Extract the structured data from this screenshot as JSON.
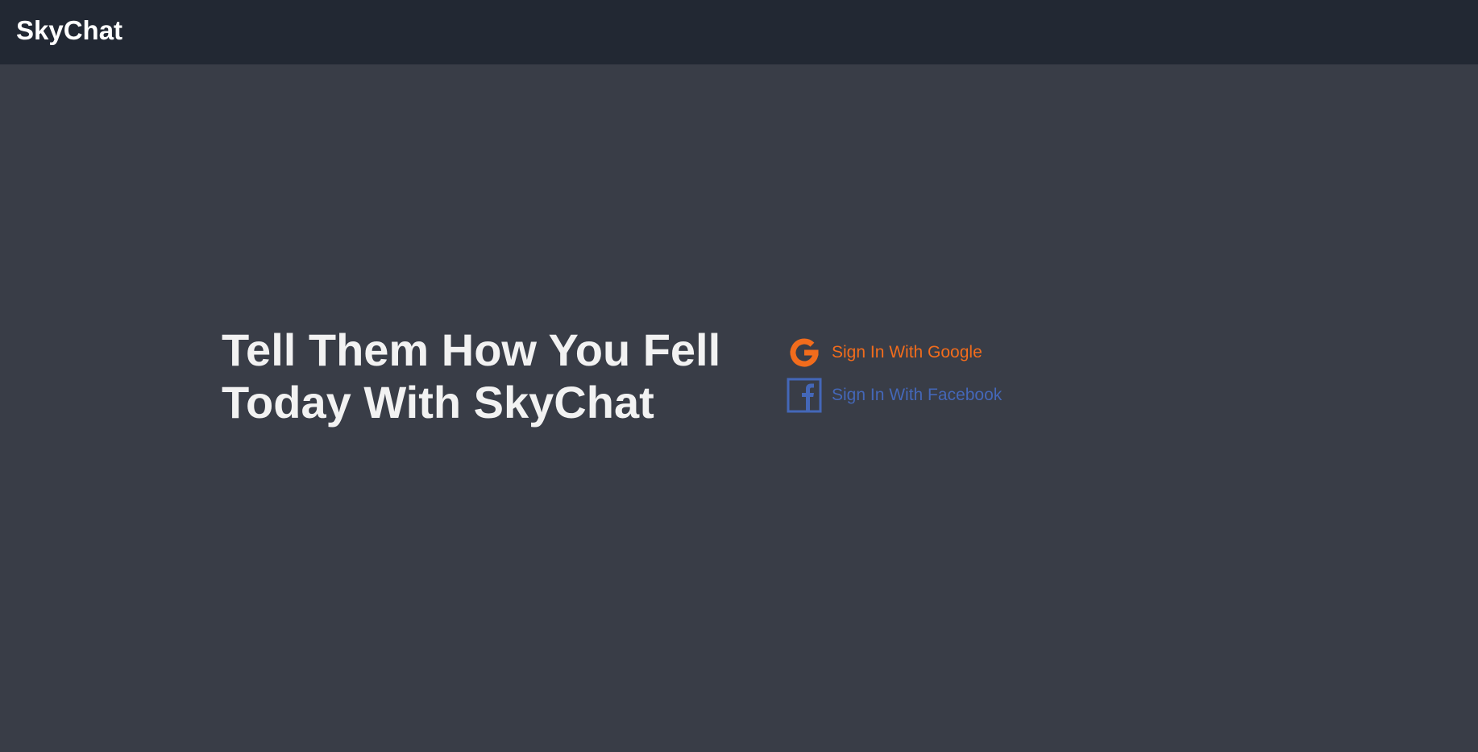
{
  "header": {
    "brand": "SkyChat"
  },
  "hero": {
    "headline": "Tell Them How You Fell Today With SkyChat"
  },
  "auth": {
    "google": {
      "label": "Sign In With Google",
      "icon": "google-icon",
      "color": "#f26c1c"
    },
    "facebook": {
      "label": "Sign In With Facebook",
      "icon": "facebook-icon",
      "color": "#4467b8"
    }
  },
  "colors": {
    "header_bg": "#222833",
    "page_bg": "#393d47",
    "headline": "#f2f2f2"
  }
}
